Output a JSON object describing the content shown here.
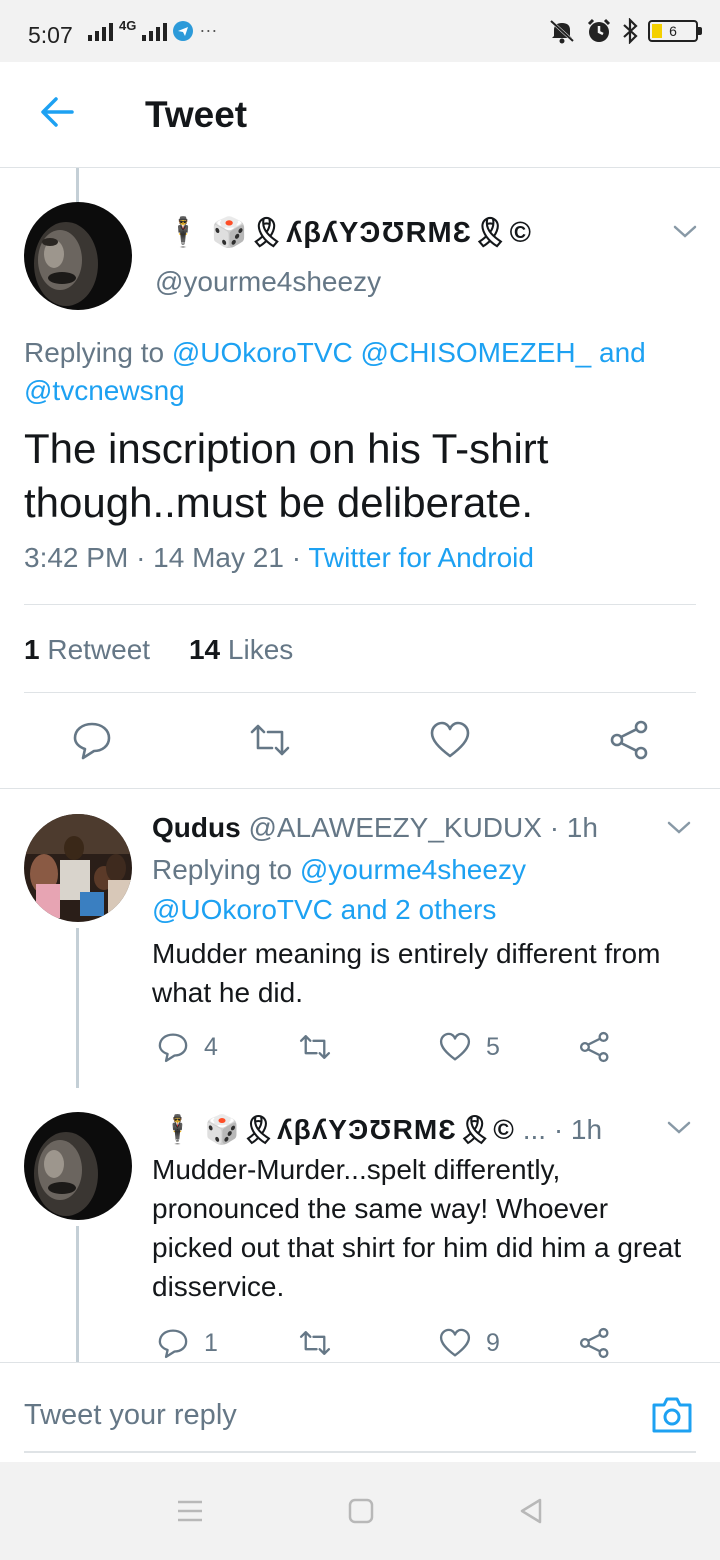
{
  "status_bar": {
    "time": "5:07",
    "network": "4G",
    "more": "···",
    "battery": "6"
  },
  "header": {
    "title": "Tweet"
  },
  "main_tweet": {
    "display_name": "🕴 🎲🎗ʎβʎYϿƱRMƐ🎗©",
    "handle": "@yourme4sheezy",
    "replying_prefix": "Replying to",
    "replying_to": "@UOkoroTVC @CHISOMEZEH_",
    "replying_and": "and",
    "replying_last": "@tvcnewsng",
    "text": "The inscription on his T-shirt though..must be deliberate.",
    "time": "3:42 PM",
    "date": "14 May 21",
    "source": "Twitter for Android",
    "retweets_count": "1",
    "retweets_label": "Retweet",
    "likes_count": "14",
    "likes_label": "Likes"
  },
  "replies": [
    {
      "name": "Qudus",
      "handle": "@ALAWEEZY_KUDUX",
      "time": "· 1h",
      "replying_prefix": "Replying to",
      "replying_to": "@yourme4sheezy",
      "replying_rest": "@UOkoroTVC and 2 others",
      "text": "Mudder meaning is entirely different from what he did.",
      "replies": "4",
      "likes": "5"
    },
    {
      "name": "🕴 🎲🎗ʎβʎYϿƱRMƐ🎗©",
      "handle": "...",
      "time": "· 1h",
      "text": "Mudder-Murder...spelt differently, pronounced the same way! Whoever picked out that shirt for him did him a great disservice.",
      "replies": "1",
      "likes": "9"
    }
  ],
  "reply_bar": {
    "placeholder": "Tweet your reply"
  },
  "colors": {
    "accent": "#1da1f2",
    "muted": "#657786",
    "text": "#14171a",
    "divider": "#dfe3e6"
  }
}
